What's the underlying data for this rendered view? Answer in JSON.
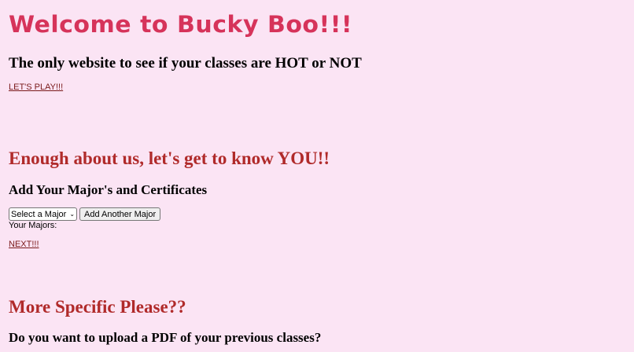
{
  "header": {
    "title": "Welcome to Bucky Boo!!!",
    "tagline": "The only website to see if your classes are HOT or NOT",
    "play_link": "LET'S PLAY!!!"
  },
  "majors_section": {
    "title": "Enough about us, let's get to know YOU!!",
    "heading": "Add Your Major's and Certificates",
    "select_value": "Select a Major",
    "add_button": "Add Another Major",
    "your_majors_label": "Your Majors:",
    "next_link": "NEXT!!!"
  },
  "specific_section": {
    "title": "More Specific Please??",
    "pdf_question": "Do you want to upload a PDF of your previous classes?"
  },
  "colors": {
    "background": "#fbe4f4",
    "logo": "#d6335a",
    "section_title": "#b02a2a",
    "link": "#7a1a1a"
  },
  "icons": {
    "select_chevron": "chevron-down-icon"
  }
}
